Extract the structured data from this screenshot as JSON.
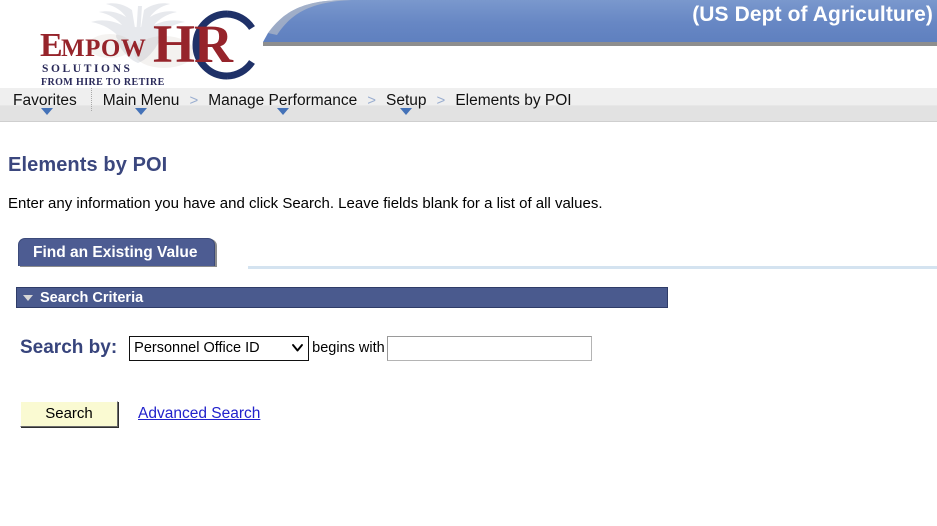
{
  "header": {
    "agency_title": "(US Dept of Agriculture)",
    "banner_color": "#6688c3",
    "banner_border_color": "#8c8c8c",
    "logo": {
      "name": "empowhr-logo",
      "word_mark_1": "E",
      "word_mark_2": "MPOW",
      "word_mark_hr": "HR",
      "tagline_1": "S O L U T I O N S",
      "tagline_2": "FROM HIRE TO RETIRE",
      "brand_red": "#96242b",
      "brand_navy": "#1f3168"
    }
  },
  "nav": {
    "items": [
      {
        "label": "Favorites",
        "has_caret": true,
        "separator_after": false
      },
      {
        "label": "Main Menu",
        "has_caret": true,
        "separator_after": true
      },
      {
        "label": "Manage Performance",
        "has_caret": true,
        "separator_after": true
      },
      {
        "label": "Setup",
        "has_caret": true,
        "separator_after": true
      },
      {
        "label": "Elements by POI",
        "has_caret": false,
        "separator_after": false
      }
    ],
    "separator_glyph": ">",
    "caret_color": "#4472b8"
  },
  "main": {
    "page_title": "Elements by POI",
    "instruction": "Enter any information you have and click Search. Leave fields blank for a list of all values.",
    "tabs": [
      {
        "label": "Find an Existing Value",
        "active": true
      }
    ],
    "criteria": {
      "section_label": "Search Criteria",
      "collapse_icon": "triangle-down-icon",
      "search_by_label": "Search by:",
      "field_select": {
        "selected": "Personnel Office ID",
        "options": [
          "Personnel Office ID"
        ],
        "chevron_icon": "chevron-down-icon"
      },
      "operator_label": "begins with",
      "value_input": {
        "value": "",
        "placeholder": ""
      }
    },
    "actions": {
      "search_button": "Search",
      "advanced_search_link": "Advanced Search"
    }
  },
  "colors": {
    "tab_active_bg": "#4d5c92",
    "criteria_bar_bg": "#4a5a8e",
    "title_text": "#3b477e",
    "link_blue": "#2222cc",
    "button_yellow": "#fafad2"
  }
}
